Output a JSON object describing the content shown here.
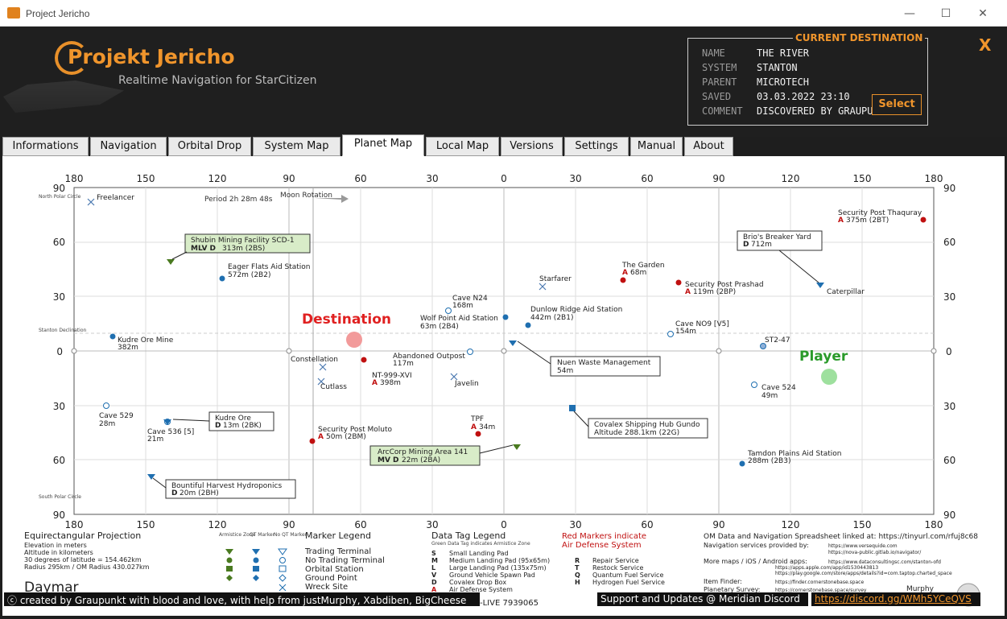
{
  "window": {
    "title": "Project Jericho",
    "minimize": "—",
    "maximize": "☐",
    "close": "✕"
  },
  "header": {
    "logo_title": "Projekt Jericho",
    "logo_subtitle": "Realtime Navigation for StarCitizen"
  },
  "destination": {
    "title": "CURRENT DESTINATION",
    "rows": [
      {
        "key": "NAME",
        "value": "THE RIVER"
      },
      {
        "key": "SYSTEM",
        "value": "STANTON"
      },
      {
        "key": "PARENT",
        "value": "MICROTECH"
      },
      {
        "key": "SAVED",
        "value": "03.03.2022 23:10"
      },
      {
        "key": "COMMENT",
        "value": "DISCOVERED BY GRAUPU"
      }
    ],
    "select_label": "Select",
    "close_label": "X"
  },
  "tabs": [
    "Informations",
    "Navigation",
    "Orbital Drop",
    "System Map",
    "Planet Map",
    "Local Map",
    "Versions",
    "Settings",
    "Manual",
    "About"
  ],
  "active_tab": "Planet Map",
  "map": {
    "top_ticks": [
      "180",
      "150",
      "120",
      "90",
      "60",
      "30",
      "0",
      "30",
      "60",
      "90",
      "120",
      "150",
      "180"
    ],
    "left_ticks": [
      "90",
      "60",
      "30",
      "0",
      "30",
      "60",
      "90"
    ],
    "right_ticks": [
      "90",
      "60",
      "30",
      "0",
      "30",
      "60",
      "90"
    ],
    "north_polar": "North Polar Circle",
    "south_polar": "South Polar Circle",
    "stanton_decl": "Stanton Declination",
    "moon_rotation": "Moon Rotation",
    "period": "Period 2h 28m 48s",
    "destination_label": "Destination",
    "player_label": "Player",
    "labels": {
      "freelancer": "Freelancer",
      "shubin_1": "Shubin Mining Facility SCD-1",
      "shubin_2a": "MLV D",
      "shubin_2b": "313m (2BS)",
      "eager_1": "Eager Flats Aid Station",
      "eager_2": "572m (2B2)",
      "kudre_mine_1": "Kudre Ore Mine",
      "kudre_mine_2": "382m",
      "cave_n24_1": "Cave N24",
      "cave_n24_2": "168m",
      "wolf_1": "Wolf Point Aid Station",
      "wolf_2": "63m (2B4)",
      "starfarer": "Starfarer",
      "dunlow_1": "Dunlow Ridge Aid Station",
      "dunlow_2": "442m (2B1)",
      "garden_1": "The Garden",
      "garden_2a": "A",
      "garden_2b": "68m",
      "prashad_1": "Security Post Prashad",
      "prashad_2a": "A",
      "prashad_2b": "119m (2BP)",
      "thaquray_1": "Security Post Thaquray",
      "thaquray_2a": "A",
      "thaquray_2b": "375m (2BT)",
      "brio_1": "Brio's Breaker Yard",
      "brio_2a": "D",
      "brio_2b": "712m",
      "caterpillar": "Caterpillar",
      "cave_n09_1": "Cave NO9 [V5]",
      "cave_n09_2": "154m",
      "st247": "ST2-47",
      "constellation": "Constellation",
      "abandoned_1": "Abandoned Outpost",
      "abandoned_2": "117m",
      "nt999_1": "NT-999-XVI",
      "nt999_2a": "A",
      "nt999_2b": "398m",
      "cutlass": "Cutlass",
      "javelin": "Javelin",
      "nuen_1": "Nuen Waste Management",
      "nuen_2": "54m",
      "cave524_1": "Cave 524",
      "cave524_2": "49m",
      "cave529_1": "Cave 529",
      "cave529_2": "28m",
      "kudre_ore_1": "Kudre Ore",
      "kudre_ore_2a": "D",
      "kudre_ore_2b": "13m (2BK)",
      "cave536_1": "Cave 536 [5]",
      "cave536_2": "21m",
      "moluto_1": "Security Post Moluto",
      "moluto_2a": "A",
      "moluto_2b": "50m (2BM)",
      "tpf_1": "TPF",
      "tpf_2a": "A",
      "tpf_2b": "34m",
      "covalex_1": "Covalex Shipping Hub Gundo",
      "covalex_2": "Altitude 288.1km (22G)",
      "arccorp_1": "ArcCorp Mining Area 141",
      "arccorp_2a": "MV D",
      "arccorp_2b": "22m (2BA)",
      "tamdon_1": "Tamdon Plains Aid Station",
      "tamdon_2": "288m (2B3)",
      "bountiful_1": "Bountiful Harvest Hydroponics",
      "bountiful_2a": "D",
      "bountiful_2b": "20m (2BH)"
    }
  },
  "legend": {
    "projection_title": "Equirectangular  Projection",
    "projection_lines": [
      "Elevation in meters",
      "Altitude in kilometers",
      "30 degrees of latitude = 154.462km",
      "Radius 295km / OM Radius 430.027km"
    ],
    "moon_name": "Daymar",
    "col_headers": [
      "Armistice Zone",
      "QT Marker",
      "No QT Marker"
    ],
    "marker_legend_title": "Marker Legend",
    "marker_types": [
      "Trading Terminal",
      "No Trading Terminal",
      "Orbital Station",
      "Ground Point",
      "Wreck Site"
    ],
    "data_tag_title": "Data Tag Legend",
    "data_tag_subtitle": "Green Data Tag indicates Armistice Zone",
    "data_tags": [
      {
        "key": "S",
        "value": "Small Landing Pad"
      },
      {
        "key": "M",
        "value": "Medium Landing Pad (95x65m)"
      },
      {
        "key": "L",
        "value": "Large Landing Pad (135x75m)"
      },
      {
        "key": "V",
        "value": "Ground Vehicle Spawn Pad"
      },
      {
        "key": "D",
        "value": "Covalex Drop Box"
      },
      {
        "key": "A",
        "value": "Air Defense System"
      }
    ],
    "services": [
      {
        "key": "R",
        "value": "Repair Service"
      },
      {
        "key": "T",
        "value": "Restock Service"
      },
      {
        "key": "Q",
        "value": "Quantum Fuel Service"
      },
      {
        "key": "H",
        "value": "Hydrogen Fuel Service"
      }
    ],
    "red_markers_1": "Red Markers indicate",
    "red_markers_2": "Air Defense System",
    "om_data": "OM Data and Navigation Spreadsheet linked at: https://tinyurl.com/rfuj8c68",
    "nav_services": "Navigation services provided by:",
    "nav_url_1": "https://www.versequide.com",
    "nav_url_2": "https://nova-public.gitlab.io/navigator/",
    "more_maps": "More maps / iOS / Android apps:",
    "maps_url_1": "https://www.dataconsultingsc.com/stanton-ofd",
    "maps_url_2": "https://apps.apple.com/app/id1530443813",
    "maps_url_3": "https://play.google.com/store/apps/details?id=com.taptop.charted_space",
    "item_finder": "Item Finder:",
    "item_finder_url": "https://finder.cornerstonebase.space",
    "planetary_survey": "Planetary Survey:",
    "planetary_survey_url": "https://cornerstonebase.space/survey",
    "murphy": "Murphy",
    "live_version": "-LIVE 7939065"
  },
  "footer": {
    "credits": "ⓒ created by Graupunkt with blood and love, with help from justMurphy, Xabdiben, BigCheese",
    "support": "Support and Updates @ Meridian Discord",
    "discord_link": "https://discord.gg/WMh5YCeQVS"
  },
  "colors": {
    "accent": "#f0952c",
    "destination": "#e02020",
    "player": "#2a9a2a",
    "marker_blue": "#1f6fb0",
    "marker_red": "#c01010",
    "marker_green": "#4a7a20"
  }
}
